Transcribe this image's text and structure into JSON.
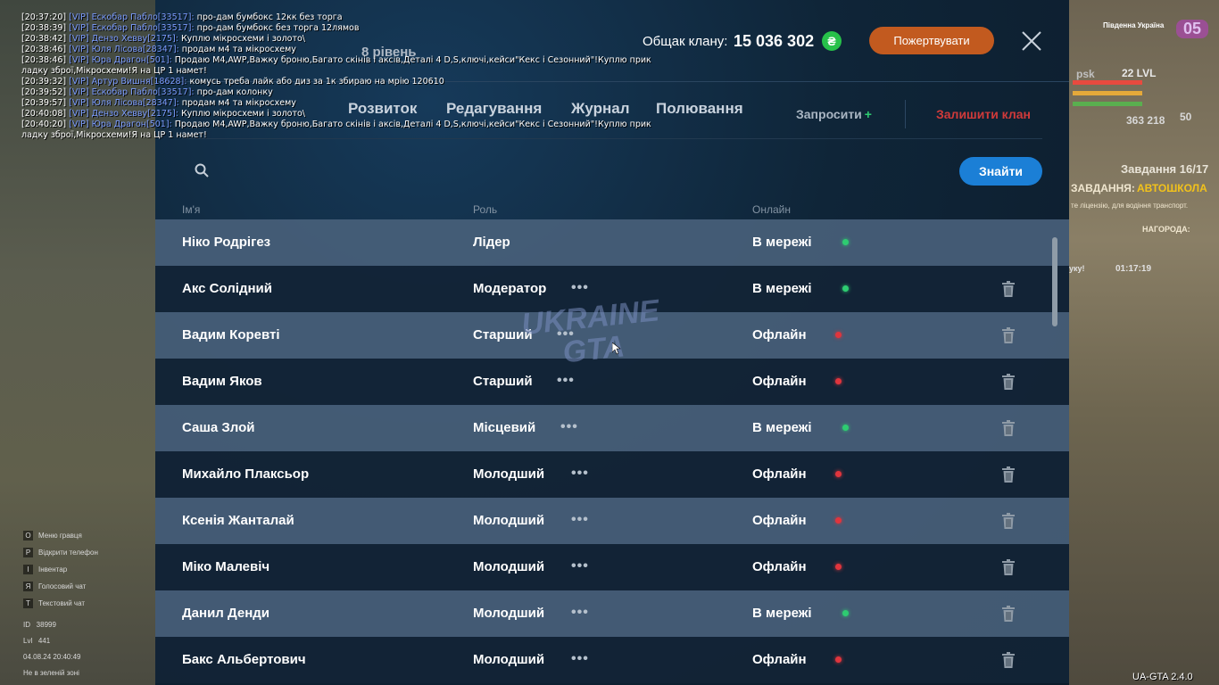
{
  "chat": [
    {
      "time": "[20:37:20]",
      "nick": "[VIP] Ескобар Пабло[33517]:",
      "text": " про-дам бумбокс 12кк без торга"
    },
    {
      "time": "[20:38:39]",
      "nick": "[VIP] Ескобар Пабло[33517]:",
      "text": " про-дам бумбокс без торга 12лямов"
    },
    {
      "time": "[20:38:42]",
      "nick": "[VIP] Дензо Хеввy[2175]:",
      "text": " Куплю мікросхеми і золото\\"
    },
    {
      "time": "[20:38:46]",
      "nick": "[VIP] Юля Лісова[28347]:",
      "text": " продам м4 та мікросхему"
    },
    {
      "time": "[20:38:46]",
      "nick": "[VIP] Юра Драгон[501]:",
      "text": " Продаю М4,AWP,Важку броню,Багато скінів і аксів,Деталі 4 D,S,ключі,кейси\"Кекс і Сезонний\"!Куплю прик"
    },
    {
      "time": "",
      "nick": "",
      "text": "ладку зброї,Мікросхеми!Я на ЦР 1 намет!"
    },
    {
      "time": "[20:39:32]",
      "nick": "[VIP] Артур Вишня[18628]:",
      "text": " комусь треба лайк або диз за 1к збираю на мрію 120610"
    },
    {
      "time": "[20:39:52]",
      "nick": "[VIP] Ескобар Пабло[33517]:",
      "text": " про-дам колонку"
    },
    {
      "time": "[20:39:57]",
      "nick": "[VIP] Юля Лісова[28347]:",
      "text": " продам м4 та мікросхему"
    },
    {
      "time": "[20:40:08]",
      "nick": "[VIP] Дензо Хеввy[2175]:",
      "text": " Куплю мікросхеми і золото\\"
    },
    {
      "time": "[20:40:20]",
      "nick": "[VIP] Юра Драгон[501]:",
      "text": " Продаю М4,AWP,Важку броню,Багато скінів і аксів,Деталі 4 D,S,ключі,кейси\"Кекс і Сезонний\"!Куплю прик"
    },
    {
      "time": "",
      "nick": "",
      "text": "ладку зброї,Мікросхеми!Я на ЦР 1 намет!"
    }
  ],
  "clan": {
    "level": "8 рівень",
    "balance_label": "Общак клану:",
    "balance": "15 036 302",
    "currency_symbol": "₴",
    "donate_label": "Пожертвувати"
  },
  "tabs": [
    "Розвиток",
    "Редагування",
    "Журнал",
    "Полювання"
  ],
  "invite_label": "Запросити",
  "leave_label": "Залишити клан",
  "search": {
    "placeholder": "",
    "button": "Знайти"
  },
  "columns": {
    "name": "Ім'я",
    "role": "Роль",
    "online": "Онлайн"
  },
  "members": [
    {
      "name": "Ніко Родрігез",
      "role": "Лідер",
      "status": "В мережі",
      "online": true
    },
    {
      "name": "Акс Солідний",
      "role": "Модератор",
      "status": "В мережі",
      "online": true
    },
    {
      "name": "Вадим Коревті",
      "role": "Старший",
      "status": "Офлайн",
      "online": false
    },
    {
      "name": "Вадим Яков",
      "role": "Старший",
      "status": "Офлайн",
      "online": false
    },
    {
      "name": "Саша Злой",
      "role": "Місцевий",
      "status": "В мережі",
      "online": true
    },
    {
      "name": "Михайло Плаксьор",
      "role": "Молодший",
      "status": "Офлайн",
      "online": false
    },
    {
      "name": "Ксенія Жанталай",
      "role": "Молодший",
      "status": "Офлайн",
      "online": false
    },
    {
      "name": "Міко Малевіч",
      "role": "Молодший",
      "status": "Офлайн",
      "online": false
    },
    {
      "name": "Данил Денди",
      "role": "Молодший",
      "status": "В мережі",
      "online": true
    },
    {
      "name": "Бакс Альбертович",
      "role": "Молодший",
      "status": "Офлайн",
      "online": false
    }
  ],
  "watermark": [
    "UKRAINE",
    "GTA"
  ],
  "hud": {
    "region": "Південна Україна",
    "badge": "05",
    "level": "22 LVL",
    "rank_label": "рsk",
    "money": "363 218",
    "ammo": "50",
    "task_title": "Завдання 16/17",
    "task_label": "ЗАВДАННЯ:",
    "task_name": "АВТОШКОЛА",
    "task_desc": "те ліцензію, для водіння транспорт.",
    "reward_label": "НАГОРОДА:",
    "timer": "01:17:19",
    "timer_prefix": "уку!"
  },
  "hints": [
    {
      "key": "O",
      "label": "Меню гравця"
    },
    {
      "key": "P",
      "label": "Відкрити телефон"
    },
    {
      "key": "I",
      "label": "Інвентар"
    },
    {
      "key": "Я",
      "label": "Голосовий чат"
    },
    {
      "key": "T",
      "label": "Текстовий чат"
    }
  ],
  "player_stats": {
    "id_label": "ID",
    "id": "38999",
    "lvl_label": "Lvl",
    "lvl": "441",
    "datetime": "04.08.24 20:40:49",
    "zone": "Не в зеленій зоні"
  },
  "version": "UA-GTA 2.4.0",
  "colors": {
    "online": "#2ecc71",
    "offline": "#e0353d",
    "accent": "#1b7fd6",
    "donate": "#c25a1f",
    "leave": "#d03a3a"
  }
}
